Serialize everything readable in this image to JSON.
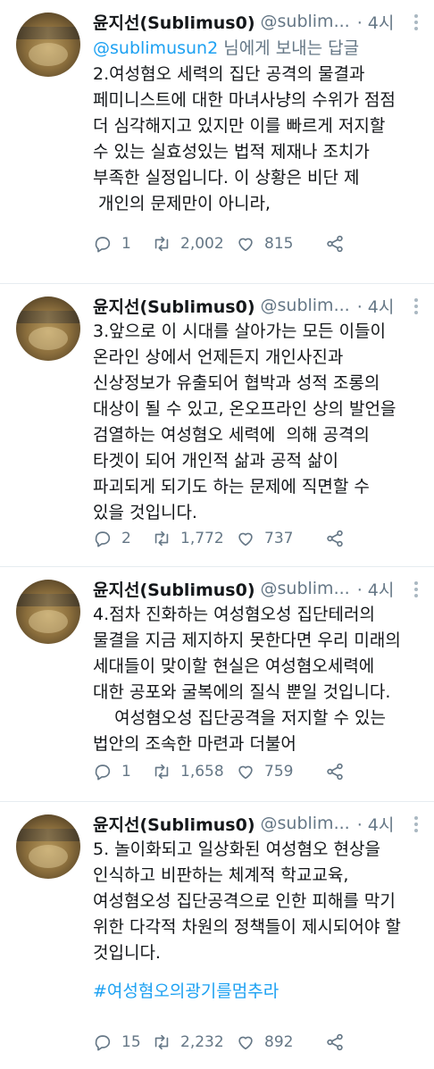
{
  "tweets": [
    {
      "name": "윤지선(Sublimus0)",
      "handle": "@sublim...",
      "time": "· 4시",
      "reply_prefix": "@sublimusun2",
      "reply_suffix": " 님에게 보내는 답글",
      "text": "2.여성혐오 세력의 집단 공격의 물결과\n페미니스트에 대한 마녀사냥의 수위가 점점\n더 심각해지고 있지만 이를 빠르게 저지할\n수 있는 실효성있는 법적 제재나 조치가\n부족한 실정입니다. 이 상황은 비단 제\n 개인의 문제만이 아니라,",
      "replies": "1",
      "retweets": "2,002",
      "likes": "815"
    },
    {
      "name": "윤지선(Sublimus0)",
      "handle": "@sublim...",
      "time": "· 4시",
      "text": "3.앞으로 이 시대를 살아가는 모든 이들이\n온라인 상에서 언제든지 개인사진과\n신상정보가 유출되어 협박과 성적 조롱의\n대상이 될 수 있고, 온오프라인 상의 발언을\n검열하는 여성혐오 세력에  의해 공격의\n타겟이 되어 개인적 삶과 공적 삶이\n파괴되게 되기도 하는 문제에 직면할 수\n있을 것입니다.",
      "replies": "2",
      "retweets": "1,772",
      "likes": "737"
    },
    {
      "name": "윤지선(Sublimus0)",
      "handle": "@sublim...",
      "time": "· 4시",
      "text": "4.점차 진화하는 여성혐오성 집단테러의\n물결을 지금 제지하지 못한다면 우리 미래의\n세대들이 맞이할 현실은 여성혐오세력에\n대한 공포와 굴복에의 질식 뿐일 것입니다.\n    여성혐오성 집단공격을 저지할 수 있는\n법안의 조속한 마련과 더불어",
      "replies": "1",
      "retweets": "1,658",
      "likes": "759"
    },
    {
      "name": "윤지선(Sublimus0)",
      "handle": "@sublim...",
      "time": "· 4시",
      "text": "5. 놀이화되고 일상화된 여성혐오 현상을\n인식하고 비판하는 체계적 학교교육,\n여성혐오성 집단공격으로 인한 피해를 막기\n위한 다각적 차원의 정책들이 제시되어야 할\n것입니다.",
      "hashtag": "#여성혐오의광기를멈추라",
      "replies": "15",
      "retweets": "2,232",
      "likes": "892"
    }
  ],
  "icons": {
    "reply": "reply-icon",
    "retweet": "retweet-icon",
    "like": "heart-icon",
    "share": "share-icon",
    "more": "more-icon"
  },
  "colors": {
    "link": "#1da1f2",
    "muted": "#657786",
    "text": "#14171a"
  }
}
